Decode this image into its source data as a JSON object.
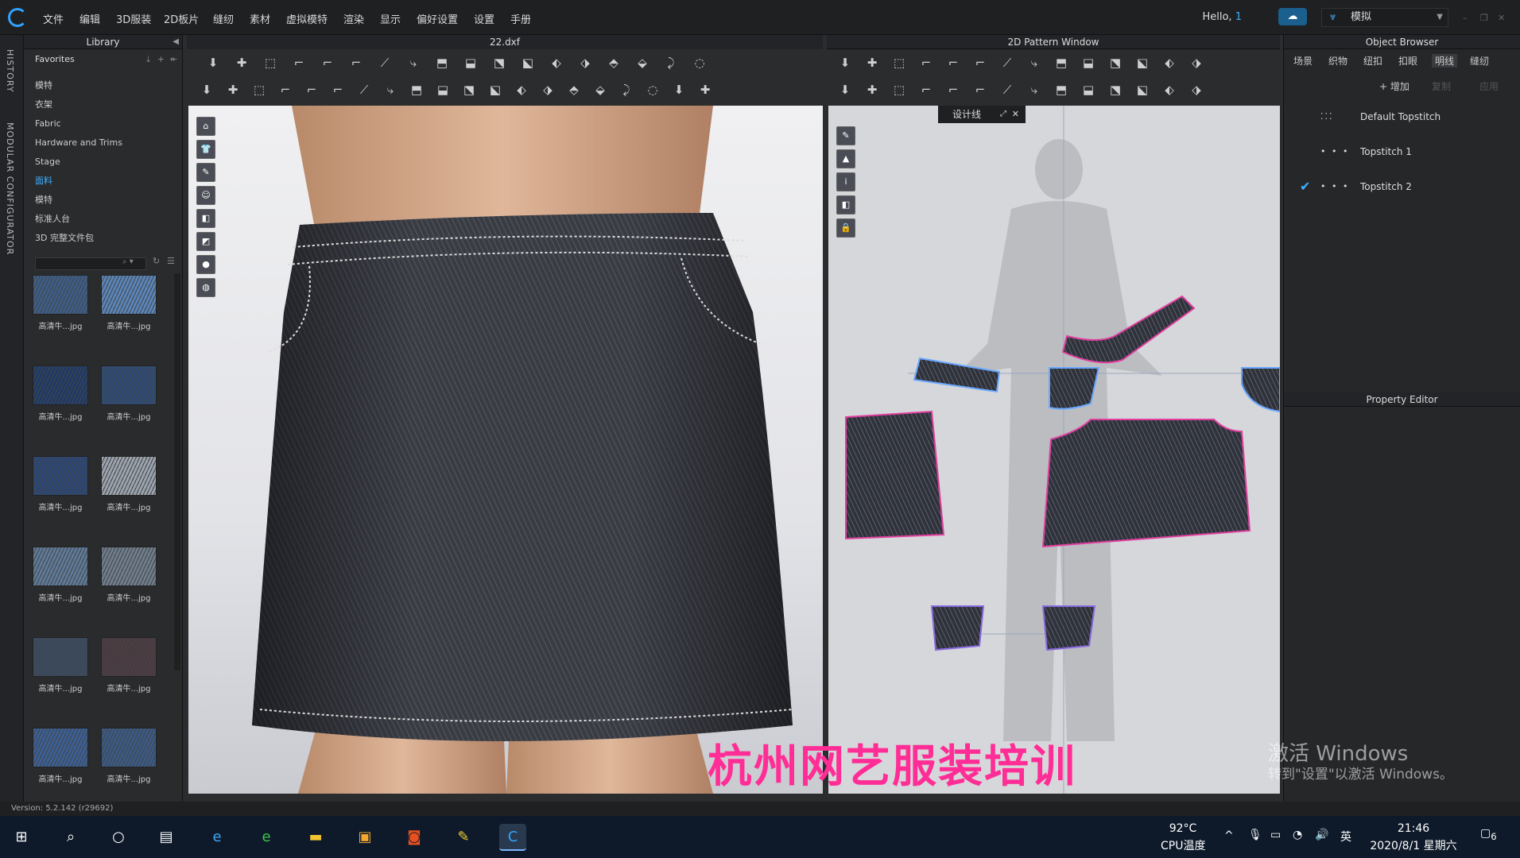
{
  "menu": {
    "items": [
      "文件",
      "编辑",
      "3D服装",
      "2D板片",
      "缝纫",
      "素材",
      "虚拟模特",
      "渲染",
      "显示",
      "偏好设置",
      "设置",
      "手册"
    ],
    "greeting": "Hello,",
    "user_number": "1",
    "mode": "模拟"
  },
  "sidetabs": [
    "HISTORY",
    "MODULAR CONFIGURATOR"
  ],
  "library": {
    "title": "Library",
    "favorites": "Favorites",
    "items": [
      "模特",
      "衣架",
      "Fabric",
      "Hardware and Trims",
      "Stage",
      "面料",
      "模特",
      "标准人台",
      "3D 完整文件包"
    ],
    "active_index": 5,
    "thumb_label": "高清牛...jpg",
    "thumb_colors": [
      "#3d5d87",
      "#5a84b8",
      "#1f3a66",
      "#2d4b78",
      "#2a4677",
      "#9aa3ad",
      "#5e7a98",
      "#6e7c8c",
      "#3a4a60",
      "#4a3a40",
      "#3b5f94",
      "#3a5a85"
    ]
  },
  "view3d": {
    "title": "22.dxf"
  },
  "view2d": {
    "title": "2D Pattern Window",
    "design_tab": "设计线"
  },
  "object_browser": {
    "title": "Object Browser",
    "tabs": [
      "场景",
      "织物",
      "纽扣",
      "扣眼",
      "明线",
      "缝纫"
    ],
    "active_tab_index": 4,
    "add_label": "+ 增加",
    "copy_label": "复制",
    "apply_label": "应用",
    "topstitches": [
      "Default Topstitch",
      "Topstitch 1",
      "Topstitch 2"
    ],
    "checked_index": 2
  },
  "property_editor": {
    "title": "Property Editor"
  },
  "version": "Version: 5.2.142 (r29692)",
  "watermark": "杭州网艺服装培训",
  "activation": {
    "line1": "激活 Windows",
    "line2": "转到\"设置\"以激活 Windows。"
  },
  "taskbar": {
    "temperature": "92°C",
    "temp_label": "CPU温度",
    "ime": "英",
    "time": "21:46",
    "date": "2020/8/1 星期六",
    "notifications": "6"
  }
}
